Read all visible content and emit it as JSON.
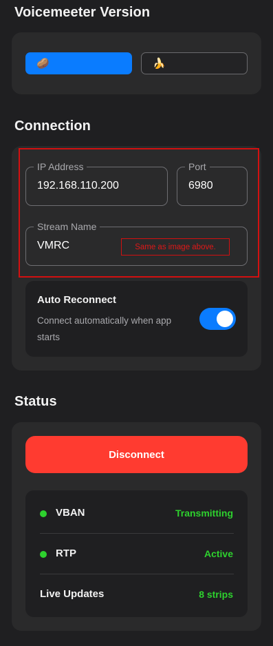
{
  "voicemeeter": {
    "title": "Voicemeeter Version",
    "options": [
      {
        "icon": "🥔",
        "icon_name": "potato-icon",
        "selected": true
      },
      {
        "icon": "🍌",
        "icon_name": "banana-icon",
        "selected": false
      }
    ]
  },
  "connection": {
    "title": "Connection",
    "ip": {
      "label": "IP Address",
      "value": "192.168.110.200"
    },
    "port": {
      "label": "Port",
      "value": "6980"
    },
    "stream": {
      "label": "Stream Name",
      "value": "VMRC"
    },
    "annotation": "Same as image above.",
    "auto_reconnect": {
      "title": "Auto Reconnect",
      "description": "Connect automatically when app starts",
      "enabled": true
    }
  },
  "status": {
    "title": "Status",
    "disconnect_label": "Disconnect",
    "rows": [
      {
        "name": "VBAN",
        "value": "Transmitting",
        "dot": true
      },
      {
        "name": "RTP",
        "value": "Active",
        "dot": true
      },
      {
        "name": "Live Updates",
        "value": "8 strips",
        "dot": false
      }
    ]
  },
  "colors": {
    "accent": "#0a7cff",
    "danger": "#ff3b30",
    "success": "#2ed12e",
    "annotation": "#d31010"
  }
}
